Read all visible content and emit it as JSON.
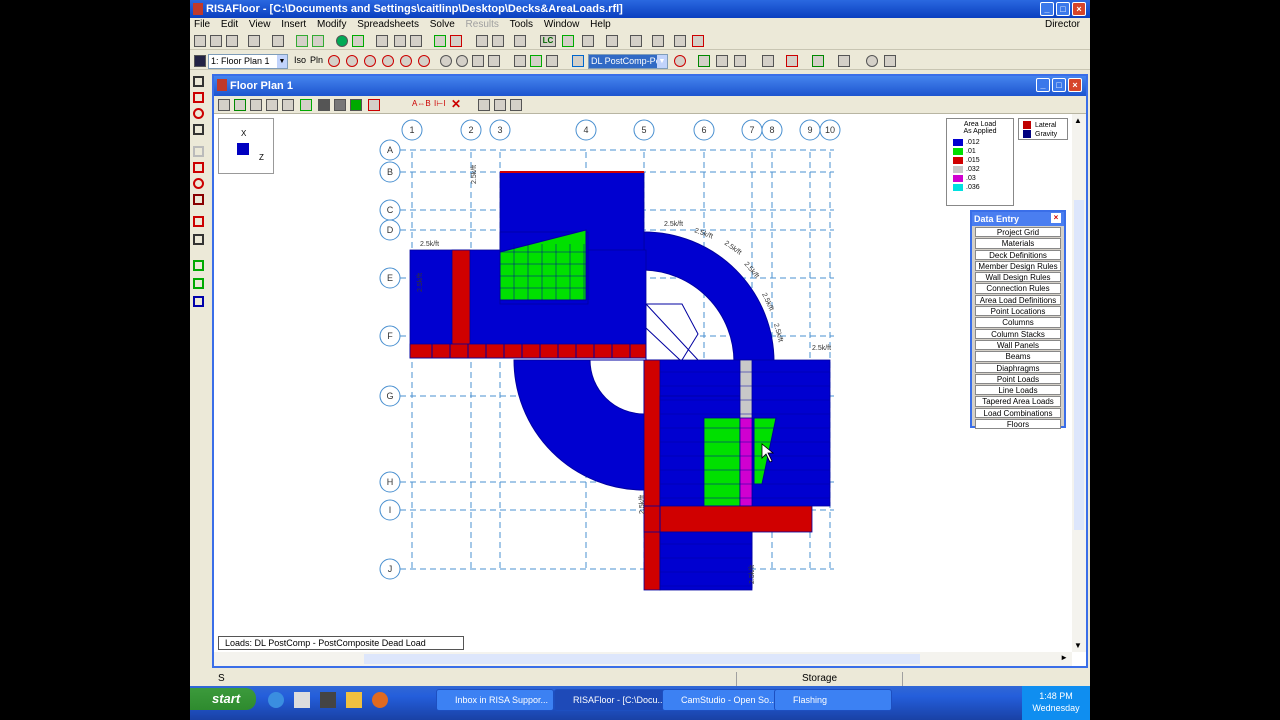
{
  "app": {
    "title": "RISAFloor - [C:\\Documents and Settings\\caitlinp\\Desktop\\Decks&AreaLoads.rfl]",
    "window_buttons": [
      "_",
      "□",
      "×"
    ]
  },
  "menu": {
    "items": [
      "File",
      "Edit",
      "View",
      "Insert",
      "Modify",
      "Spreadsheets",
      "Solve",
      "Results",
      "Tools",
      "Window",
      "Help"
    ],
    "right_label": "Director"
  },
  "toolbar2": {
    "floor_combo": "1: Floor Plan 1",
    "iso_label": "Iso",
    "pln_label": "Pln",
    "load_combo": "DL PostComp-Po"
  },
  "child": {
    "title": "Floor Plan 1",
    "load_label": "Loads: DL PostComp - PostComposite Dead Load",
    "toolbar_text": [
      "A⇔B",
      "I⊢I"
    ]
  },
  "grid": {
    "columns": [
      "1",
      "2",
      "3",
      "4",
      "5",
      "6",
      "7",
      "8",
      "9",
      "10"
    ],
    "rows": [
      "A",
      "B",
      "C",
      "D",
      "E",
      "F",
      "G",
      "H",
      "I",
      "J"
    ],
    "dim_label": "2.5k/ft"
  },
  "axes": {
    "x_label": "X",
    "z_label": "Z"
  },
  "area_legend": {
    "title1": "Area Load",
    "title2": "As Applied",
    "entries": [
      {
        "label": ".012",
        "color": "#0000d0"
      },
      {
        "label": ".01",
        "color": "#00e000"
      },
      {
        "label": ".015",
        "color": "#d00000"
      },
      {
        "label": ".032",
        "color": "#c8c8c8"
      },
      {
        "label": ".03",
        "color": "#d000d0"
      },
      {
        "label": ".036",
        "color": "#00e0e0"
      }
    ]
  },
  "member_legend": {
    "entries": [
      {
        "label": "Lateral",
        "color": "#c00000"
      },
      {
        "label": "Gravity",
        "color": "#000080"
      }
    ]
  },
  "data_entry": {
    "title": "Data Entry",
    "items": [
      "Project Grid",
      "Materials",
      "Deck Definitions",
      "Member Design Rules",
      "Wall Design Rules",
      "Connection Rules",
      "Area Load Definitions",
      "Point Locations",
      "Columns",
      "Column Stacks",
      "Wall Panels",
      "Beams",
      "Diaphragms",
      "Point Loads",
      "Line Loads",
      "Tapered Area Loads",
      "Load Combinations",
      "Floors"
    ]
  },
  "status": {
    "left": "S",
    "middle": "Storage"
  },
  "taskbar": {
    "start": "start",
    "tasks": [
      "Inbox in RISA Suppor...",
      "RISAFloor - [C:\\Docu...",
      "CamStudio - Open So...",
      "Flashing"
    ],
    "time": "1:48 PM",
    "day": "Wednesday"
  }
}
